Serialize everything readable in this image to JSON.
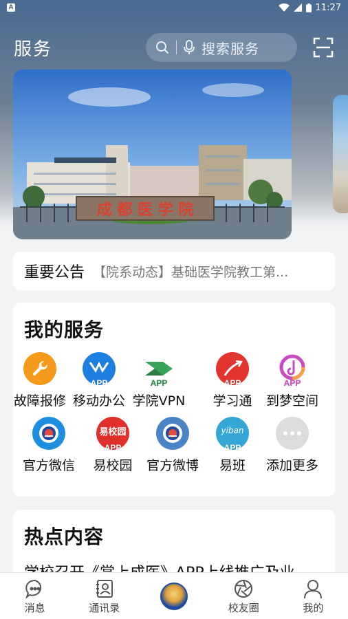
{
  "status_bar": {
    "time": "11:27",
    "app_badge": "A"
  },
  "header": {
    "title": "服务",
    "search_placeholder": "搜索服务"
  },
  "banner": {
    "gate_text": "成 都 医 学 院"
  },
  "notice": {
    "title": "重要公告",
    "text": "【院系动态】基础医学院教工第..."
  },
  "services": {
    "title": "我的服务",
    "items": [
      {
        "label": "故障报修",
        "icon": "wrench-icon",
        "color": "#f59a1b",
        "app": ""
      },
      {
        "label": "移动办公",
        "icon": "mobile-office-icon",
        "color": "#1e7fe0",
        "app": "APP"
      },
      {
        "label": "学院VPN",
        "icon": "vpn-icon",
        "color": "#3aa35a",
        "app": "APP"
      },
      {
        "label": "学习通",
        "icon": "xuexitong-icon",
        "color": "#e3342f",
        "app": "APP"
      },
      {
        "label": "到梦空间",
        "icon": "daomeng-icon",
        "color": "#c64cc0",
        "app": "APP"
      },
      {
        "label": "官方微信",
        "icon": "school-emblem-icon",
        "color": "#1d8ee0",
        "app": ""
      },
      {
        "label": "易校园",
        "icon": "yixiaoyuan-icon",
        "color": "#e0302b",
        "app": "APP"
      },
      {
        "label": "官方微博",
        "icon": "school-emblem-icon",
        "color": "#4a84c5",
        "app": ""
      },
      {
        "label": "易班",
        "icon": "yiban-icon",
        "color": "#35a7d6",
        "app": "APP"
      },
      {
        "label": "添加更多",
        "icon": "more-icon",
        "color": "#dcdcdc",
        "app": ""
      }
    ],
    "yiban_logo_text": "yiban",
    "yixiaoyuan_logo_text": "易校园"
  },
  "hot": {
    "title": "热点内容",
    "first_item": "学校召开《掌上成医》APP上线推广及业"
  },
  "tabbar": {
    "items": [
      {
        "label": "消息",
        "icon": "message-icon"
      },
      {
        "label": "通讯录",
        "icon": "contacts-icon"
      },
      {
        "label": "",
        "icon": "school-logo-icon"
      },
      {
        "label": "校友圈",
        "icon": "aperture-icon"
      },
      {
        "label": "我的",
        "icon": "profile-icon"
      }
    ]
  }
}
